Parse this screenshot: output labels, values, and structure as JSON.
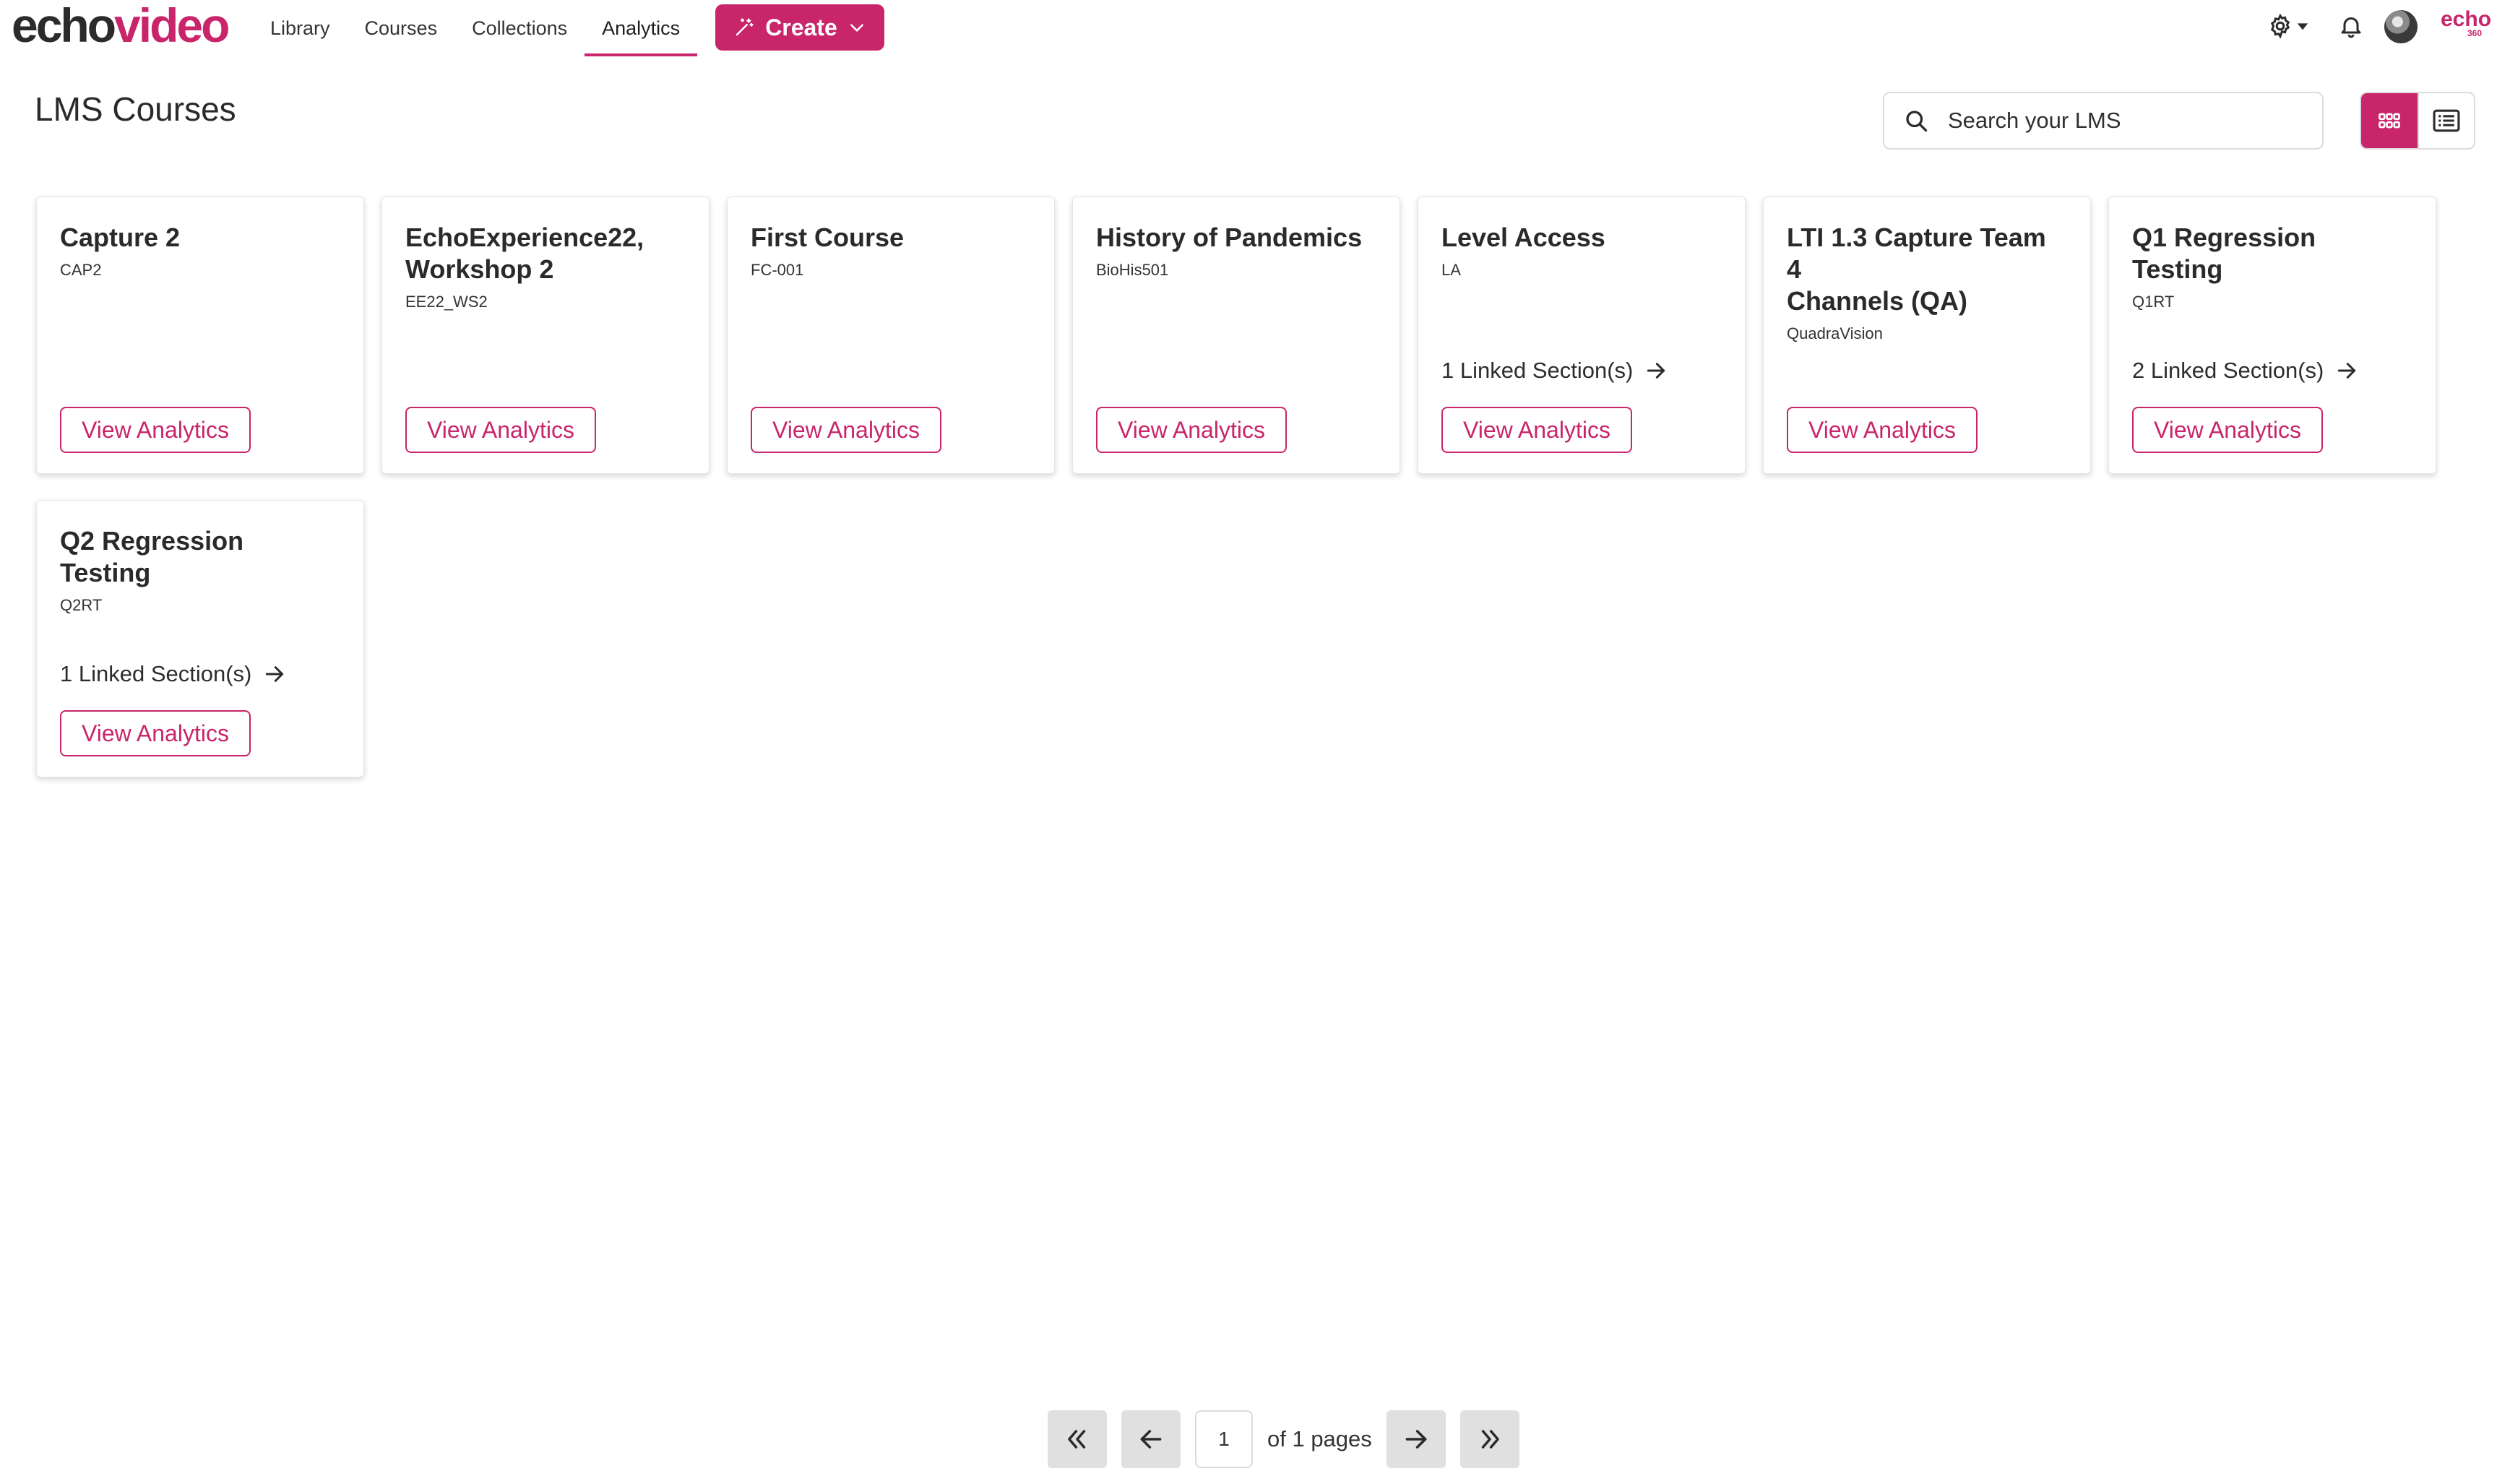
{
  "app": {
    "logo_part1": "echo",
    "logo_part2": "video",
    "brand_mini": "echo",
    "brand_mini_sub": "360"
  },
  "nav": {
    "items": [
      {
        "label": "Library"
      },
      {
        "label": "Courses"
      },
      {
        "label": "Collections"
      },
      {
        "label": "Analytics",
        "active": true
      }
    ],
    "create_label": "Create"
  },
  "page": {
    "title": "LMS Courses",
    "search_placeholder": "Search your LMS"
  },
  "courses": [
    {
      "title_lines": [
        "Capture 2"
      ],
      "code": "CAP2",
      "linked": "",
      "button": "View Analytics"
    },
    {
      "title_lines": [
        "EchoExperience22,",
        "Workshop 2"
      ],
      "code": "EE22_WS2",
      "linked": "",
      "button": "View Analytics"
    },
    {
      "title_lines": [
        "First Course"
      ],
      "code": "FC-001",
      "linked": "",
      "button": "View Analytics"
    },
    {
      "title_lines": [
        "History of Pandemics"
      ],
      "code": "BioHis501",
      "linked": "",
      "button": "View Analytics"
    },
    {
      "title_lines": [
        "Level Access"
      ],
      "code": "LA",
      "linked": "1 Linked Section(s)",
      "button": "View Analytics"
    },
    {
      "title_lines": [
        "LTI 1.3 Capture Team 4",
        "Channels (QA)"
      ],
      "code": "QuadraVision",
      "linked": "",
      "button": "View Analytics"
    },
    {
      "title_lines": [
        "Q1 Regression Testing"
      ],
      "code": "Q1RT",
      "linked": "2 Linked Section(s)",
      "button": "View Analytics"
    },
    {
      "title_lines": [
        "Q2 Regression Testing"
      ],
      "code": "Q2RT",
      "linked": "1 Linked Section(s)",
      "button": "View Analytics"
    }
  ],
  "pagination": {
    "current_page": "1",
    "of_pages": "of 1 pages"
  },
  "colors": {
    "accent": "#c8256a",
    "text": "#2b2b2b",
    "pager_button": "#e0e0e0"
  },
  "icons": {
    "create": "magic-wand-icon",
    "create_caret": "chevron-down-icon",
    "settings": "gear-icon",
    "notifications": "bell-icon",
    "search": "search-icon",
    "grid_view": "grid-icon",
    "list_view": "list-icon",
    "linked_arrow": "arrow-right-icon",
    "first_page": "double-chevron-left-icon",
    "prev_page": "arrow-left-icon",
    "next_page": "arrow-right-icon",
    "last_page": "double-chevron-right-icon"
  }
}
